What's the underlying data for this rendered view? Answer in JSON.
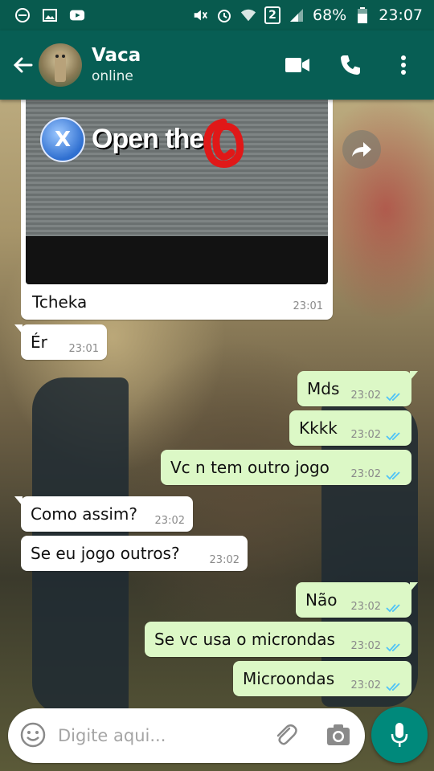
{
  "status_bar": {
    "battery_percent": "68%",
    "time": "23:07",
    "sim_badge": "2"
  },
  "header": {
    "contact_name": "Vaca",
    "contact_status": "online"
  },
  "image_message": {
    "image_text": "Open the",
    "button_glyph": "X",
    "caption": "Tcheka",
    "time": "23:01"
  },
  "messages": [
    {
      "id": "m1",
      "direction": "in",
      "text": "Ér",
      "time": "23:01"
    },
    {
      "id": "m2",
      "direction": "out",
      "text": "Mds",
      "time": "23:02"
    },
    {
      "id": "m3",
      "direction": "out",
      "text": "Kkkk",
      "time": "23:02"
    },
    {
      "id": "m4",
      "direction": "out",
      "text": "Vc n tem outro jogo",
      "time": "23:02"
    },
    {
      "id": "m5",
      "direction": "in",
      "text": "Como assim?",
      "time": "23:02"
    },
    {
      "id": "m6",
      "direction": "in",
      "text": "Se eu jogo outros?",
      "time": "23:02"
    },
    {
      "id": "m7",
      "direction": "out",
      "text": "Não",
      "time": "23:02"
    },
    {
      "id": "m8",
      "direction": "out",
      "text": "Se vc usa o microndas",
      "time": "23:02"
    },
    {
      "id": "m9",
      "direction": "out",
      "text": "Microondas",
      "time": "23:02"
    }
  ],
  "composer": {
    "placeholder": "Digite aqui..."
  },
  "colors": {
    "header": "#075e54",
    "status_bar": "#085a4e",
    "outgoing_bubble": "#dcf8c6",
    "incoming_bubble": "#ffffff",
    "read_ticks": "#4fc3f7",
    "fab": "#00897b"
  },
  "icons": [
    "minus-circle-icon",
    "image-icon",
    "youtube-icon",
    "mute-icon",
    "alarm-icon",
    "wifi-icon",
    "signal-icon",
    "battery-icon",
    "back-arrow-icon",
    "video-call-icon",
    "phone-icon",
    "more-vert-icon",
    "forward-icon",
    "emoji-icon",
    "attach-icon",
    "camera-icon",
    "mic-icon",
    "double-tick-icon"
  ]
}
